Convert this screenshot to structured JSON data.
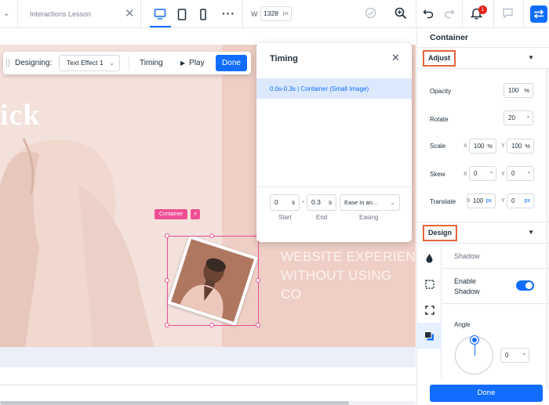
{
  "topbar": {
    "page_name": "Interactions Lesson",
    "width_label": "W",
    "width_value": "1328",
    "width_unit": "px",
    "notification_count": "1",
    "accent_color": "#116dff"
  },
  "canvas": {
    "hero_text": "ick",
    "hero_line1": "WEBSITE EXPERIEN",
    "hero_line2": "WITHOUT USING CO",
    "container_label": "Container",
    "bolt_icon": "⚡"
  },
  "designbar": {
    "label": "Designing:",
    "effect_value": "Text Effect 1",
    "timing_label": "Timing",
    "play_label": "Play",
    "done_label": "Done"
  },
  "timing_panel": {
    "title": "Timing",
    "row_text": "0.0s-0.3s | Container (Small Image)",
    "start_value": "0",
    "start_unit": "s",
    "end_value": "0.3",
    "end_unit": "s",
    "easing_value": "Ease In an...",
    "dash": "-",
    "start_caption": "Start",
    "end_caption": "End",
    "easing_caption": "Easing"
  },
  "right_panel": {
    "title": "Container",
    "adjust_label": "Adjust",
    "opacity_label": "Opacity",
    "opacity_value": "100",
    "opacity_unit": "%",
    "rotate_label": "Rotate",
    "rotate_value": "20",
    "rotate_unit": "°",
    "scale_label": "Scale",
    "scale_x": "100",
    "scale_y": "100",
    "scale_unit": "%",
    "skew_label": "Skew",
    "skew_x": "0",
    "skew_y": "0",
    "skew_unit": "°",
    "translate_label": "Translate",
    "translate_x": "100",
    "translate_y": "0",
    "translate_unit": "px",
    "axis_x": "X",
    "axis_y": "Y",
    "design_label": "Design",
    "shadow_title": "Shadow",
    "enable_shadow": "Enable Shadow",
    "angle_label": "Angle",
    "angle_value": "0",
    "angle_unit": "°",
    "done_label": "Done",
    "highlight_color": "#e3653c"
  }
}
